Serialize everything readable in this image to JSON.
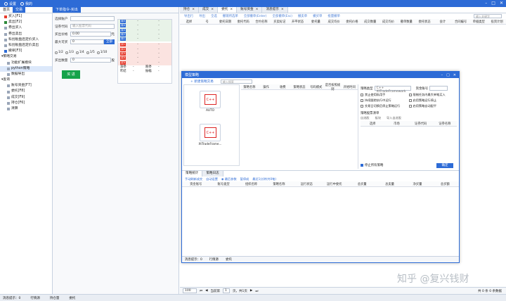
{
  "titlebar": {
    "items": [
      "设置",
      "我的"
    ]
  },
  "left": {
    "tabs": [
      "首页",
      "交易"
    ],
    "items": [
      {
        "label": "买入[F1]",
        "indent": 1,
        "color": "#e63a2c"
      },
      {
        "label": "卖出[F2]",
        "indent": 1,
        "color": "#2d8a3a"
      },
      {
        "label": "券出买入",
        "indent": 1
      },
      {
        "label": "券出卖出",
        "indent": 1
      },
      {
        "label": "科创板盘后定价买入",
        "indent": 1
      },
      {
        "label": "科创板盘后定价卖出",
        "indent": 1
      },
      {
        "label": "撤单[F3]",
        "indent": 1,
        "color": "#2d6bd6"
      },
      {
        "label": "策略交易",
        "indent": 0,
        "expand": true
      },
      {
        "label": "功能扩展模块",
        "indent": 2
      },
      {
        "label": "python策略",
        "indent": 2,
        "selected": true
      },
      {
        "label": "数据导出",
        "indent": 2
      },
      {
        "label": "查询",
        "indent": 0,
        "expand": true
      },
      {
        "label": "账号资金[F7]",
        "indent": 2
      },
      {
        "label": "委托[F8]",
        "indent": 2
      },
      {
        "label": "成交[F9]",
        "indent": 2
      },
      {
        "label": "持仓[F6]",
        "indent": 2
      },
      {
        "label": "清算",
        "indent": 2
      }
    ]
  },
  "order": {
    "tab": "下单指令-买出",
    "fields": [
      {
        "label": "选择账户",
        "value": "",
        "type": "select"
      },
      {
        "label": "证券代码",
        "value": "输入股票代码",
        "type": "text"
      },
      {
        "label": "买出价格",
        "value": "0.00",
        "unit": "元",
        "type": "spin"
      },
      {
        "label": "最大可买",
        "value": "0",
        "unit": "股",
        "type": "text",
        "btn": "全部"
      }
    ],
    "radios": [
      "1/2",
      "1/3",
      "1/4",
      "1/5",
      "1/10"
    ],
    "qty_label": "买出数量",
    "qty_value": "0",
    "qty_unit": "股",
    "buy_button": "买 进",
    "book": {
      "sells": [
        "卖5",
        "卖4",
        "卖3",
        "卖2",
        "卖1"
      ],
      "buys": [
        "买1",
        "买2",
        "买3",
        "买4",
        "买5"
      ],
      "dash": "-",
      "footer": [
        [
          "涨停",
          "-",
          "跌停",
          "-"
        ],
        [
          "昨结",
          "-",
          "振幅",
          "-"
        ]
      ]
    }
  },
  "main": {
    "tabs": [
      "持仓",
      "成交",
      "委托",
      "账号资金",
      "消息提示"
    ],
    "toolbar": [
      "导出行",
      "导出",
      "全选",
      "撤销所选单",
      "全部撤单(Enter)",
      "全部撤单(Esc)",
      "撤卖单",
      "撤买单",
      "批量撤单"
    ],
    "search_placeholder": "输入关键字",
    "columns": [
      "选择",
      "号",
      "委托日期",
      "委托代码",
      "合约名称",
      "买卖标记",
      "开平状态",
      "委托量",
      "成交均价",
      "委托价格",
      "成交数量",
      "成交均价",
      "撤单数量",
      "委托状态",
      "会计",
      "合同编号",
      "单据类型",
      "投资计划"
    ],
    "pager": {
      "size": "100",
      "page_label": "当前第",
      "page": "1",
      "of": "页，共1页",
      "right": "共 0 条 0 条数据"
    }
  },
  "dialog": {
    "title": "模型策略",
    "toolbar": "+ 新建策略交易",
    "search": "输入搜索",
    "cards": [
      {
        "label": "AUTO",
        "icon": "C++"
      },
      {
        "label": "XtTradeFrame...",
        "icon": "C++"
      }
    ],
    "table_cols": [
      "策略名称",
      "操作",
      "收费",
      "策略状态",
      "号码模式",
      "是否按照规则",
      "开始时间"
    ],
    "right": {
      "strategy_label": "策略类型",
      "strategy_value": "C++ XtTradeFramework",
      "account_label": "资金账号",
      "checks": [
        {
          "label": "禁止使用私用手",
          "checked": false
        },
        {
          "label": "限制任务内最大单笔买入",
          "checked": false
        },
        {
          "label": "持续跟踪执行中运行",
          "checked": false
        },
        {
          "label": "启用策略运行停止",
          "checked": false
        },
        {
          "label": "交易日切换后停止策略运行",
          "checked": false
        },
        {
          "label": "启用策略自动配平",
          "checked": false
        }
      ],
      "subtitle": "策略股票清单",
      "subcols": [
        "选择",
        "市场",
        "证券代码",
        "证券名称"
      ],
      "tabs_small": [
        "自选股",
        "板块",
        "导入自选股"
      ],
      "extra_check": "停止所有策略",
      "ok": "确定"
    },
    "bottom_tabs": [
      "策略统计",
      "策略日志"
    ],
    "bottom_toolbar": [
      "手动刷新成交",
      "自动设置",
      "◉ 最后参数",
      "暂停成",
      "最近1分钟(共0笔)"
    ],
    "bottom_cols": [
      "资金账号",
      "账号类型",
      "组织名称",
      "策略名称",
      "运行状态",
      "运行中委托",
      "总买量",
      "总卖量",
      "净买量",
      "总买额"
    ],
    "footer": {
      "msg": "消息提示：0",
      "trade": "行情源",
      "order": "委托"
    }
  },
  "statusbar": {
    "msg": "消息提示：0",
    "items": [
      "行情源",
      "持仓量",
      "委托"
    ]
  },
  "watermark": "知乎 @复兴钱财"
}
